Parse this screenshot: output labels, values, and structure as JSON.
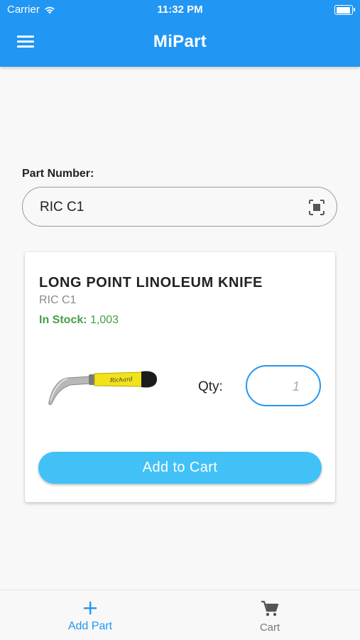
{
  "status_bar": {
    "carrier": "Carrier",
    "time": "11:32 PM"
  },
  "header": {
    "title": "MiPart"
  },
  "search": {
    "label": "Part Number:",
    "value": "RIC C1"
  },
  "product": {
    "name": "LONG POINT LINOLEUM KNIFE",
    "part_number": "RIC C1",
    "stock_label": "In Stock:",
    "stock_value": "1,003",
    "image_brand_text": "Richard",
    "qty_label": "Qty:",
    "qty_placeholder": "1",
    "add_button_label": "Add to Cart"
  },
  "tabs": [
    {
      "label": "Add Part",
      "icon": "plus-icon",
      "active": true
    },
    {
      "label": "Cart",
      "icon": "cart-icon",
      "active": false
    }
  ],
  "colors": {
    "primary": "#2196f3",
    "button": "#42c1f7",
    "stock_green": "#43a047",
    "tab_inactive": "#777777"
  }
}
